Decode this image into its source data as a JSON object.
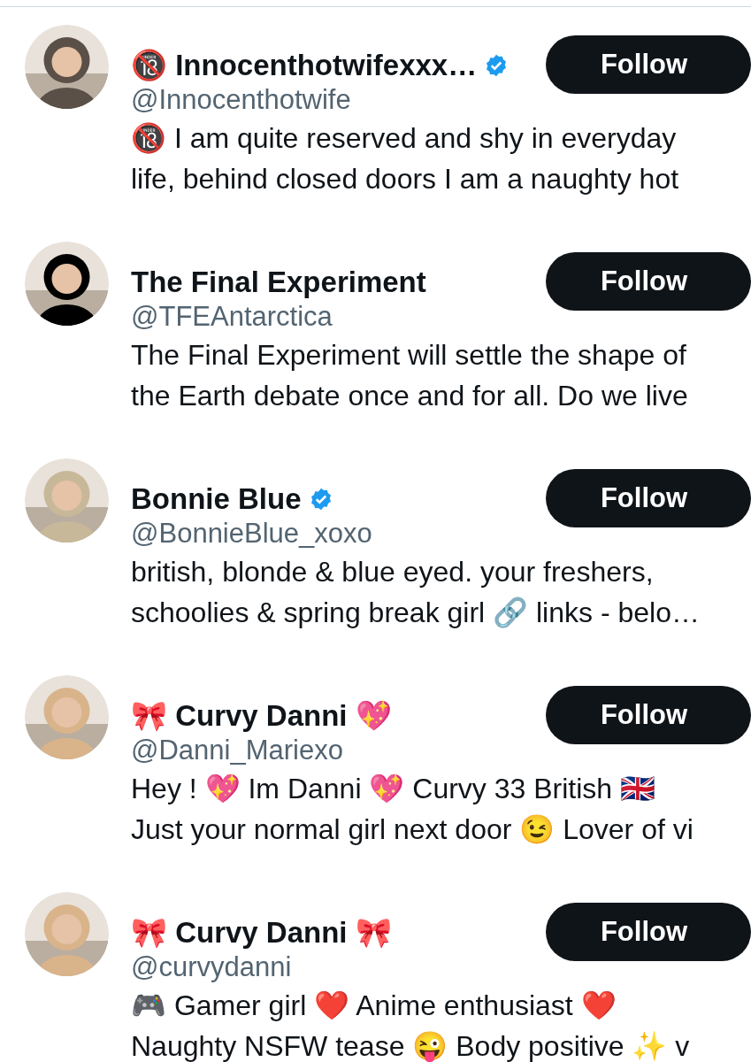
{
  "accounts": [
    {
      "name": "🔞 Innocenthotwifexxx…",
      "verified": true,
      "handle": "@Innocenthotwife",
      "button": "Follow",
      "bio_lines": [
        "🔞 I am quite reserved and shy in everyday",
        "life, behind closed doors I am a naughty hot"
      ]
    },
    {
      "name": "The Final Experiment",
      "verified": false,
      "handle": "@TFEAntarctica",
      "button": "Follow",
      "bio_lines": [
        "The Final Experiment will settle the shape of",
        "the Earth debate once and for all. Do we live"
      ]
    },
    {
      "name": "Bonnie Blue",
      "verified": true,
      "handle": "@BonnieBlue_xoxo",
      "button": "Follow",
      "bio_lines": [
        "british, blonde & blue eyed. your freshers,",
        "schoolies & spring break girl 🔗 links - belo…"
      ]
    },
    {
      "name": "🎀 Curvy Danni 💖",
      "verified": false,
      "handle": "@Danni_Mariexo",
      "button": "Follow",
      "bio_lines": [
        "Hey ! 💖 Im Danni 💖 Curvy 33 British 🇬🇧",
        "Just your normal girl next door 😉 Lover of vi"
      ]
    },
    {
      "name": "🎀 Curvy Danni 🎀",
      "verified": false,
      "handle": "@curvydanni",
      "button": "Follow",
      "bio_lines": [
        "🎮 Gamer girl ❤️ Anime enthusiast ❤️",
        "Naughty NSFW tease 😜 Body positive ✨ v"
      ]
    }
  ]
}
